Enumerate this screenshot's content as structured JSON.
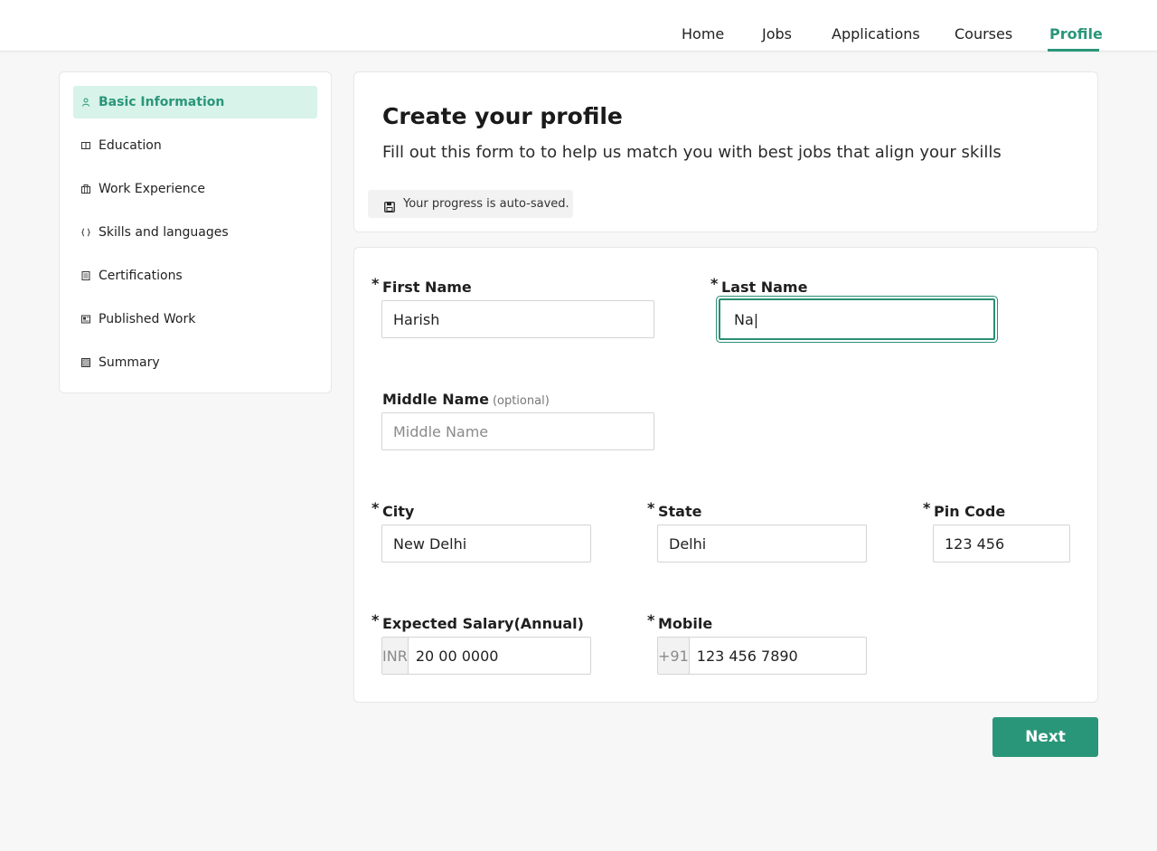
{
  "nav": {
    "items": [
      {
        "label": "Home",
        "active": false
      },
      {
        "label": "Jobs",
        "active": false
      },
      {
        "label": "Applications",
        "active": false
      },
      {
        "label": "Courses",
        "active": false
      },
      {
        "label": "Profile",
        "active": true
      }
    ]
  },
  "sidebar": {
    "items": [
      {
        "label": "Basic Information",
        "icon": "person-icon",
        "active": true
      },
      {
        "label": "Education",
        "icon": "book-icon",
        "active": false
      },
      {
        "label": "Work Experience",
        "icon": "briefcase-icon",
        "active": false
      },
      {
        "label": "Skills and languages",
        "icon": "braces-icon",
        "active": false
      },
      {
        "label": "Certifications",
        "icon": "certificate-icon",
        "active": false
      },
      {
        "label": "Published Work",
        "icon": "publication-icon",
        "active": false
      },
      {
        "label": "Summary",
        "icon": "summary-icon",
        "active": false
      }
    ]
  },
  "header": {
    "title": "Create your profile",
    "subtitle": "Fill out this form to to help us match you with best jobs that align your skills",
    "autosave": "Your progress is auto-saved.",
    "autosave_icon": "save-icon"
  },
  "form": {
    "first_name": {
      "label": "First Name",
      "required": "*",
      "value": "Harish"
    },
    "last_name": {
      "label": "Last Name",
      "required": "*",
      "value": "Na|"
    },
    "middle_name": {
      "label": "Middle Name",
      "optional": "(optional)",
      "placeholder": "Middle Name",
      "value": ""
    },
    "city": {
      "label": "City",
      "required": "*",
      "value": "New Delhi"
    },
    "state": {
      "label": "State",
      "required": "*",
      "value": "Delhi"
    },
    "pin_code": {
      "label": "Pin Code",
      "required": "*",
      "value": "123 456"
    },
    "salary": {
      "label": "Expected Salary(Annual)",
      "required": "*",
      "prefix": "INR",
      "value": "20 00 0000"
    },
    "mobile": {
      "label": "Mobile",
      "required": "*",
      "prefix": "+91",
      "value": "123 456 7890"
    }
  },
  "actions": {
    "next_label": "Next"
  },
  "colors": {
    "accent": "#2a9679",
    "accent_light": "#d7f3ea",
    "background": "#f7f7f7"
  }
}
